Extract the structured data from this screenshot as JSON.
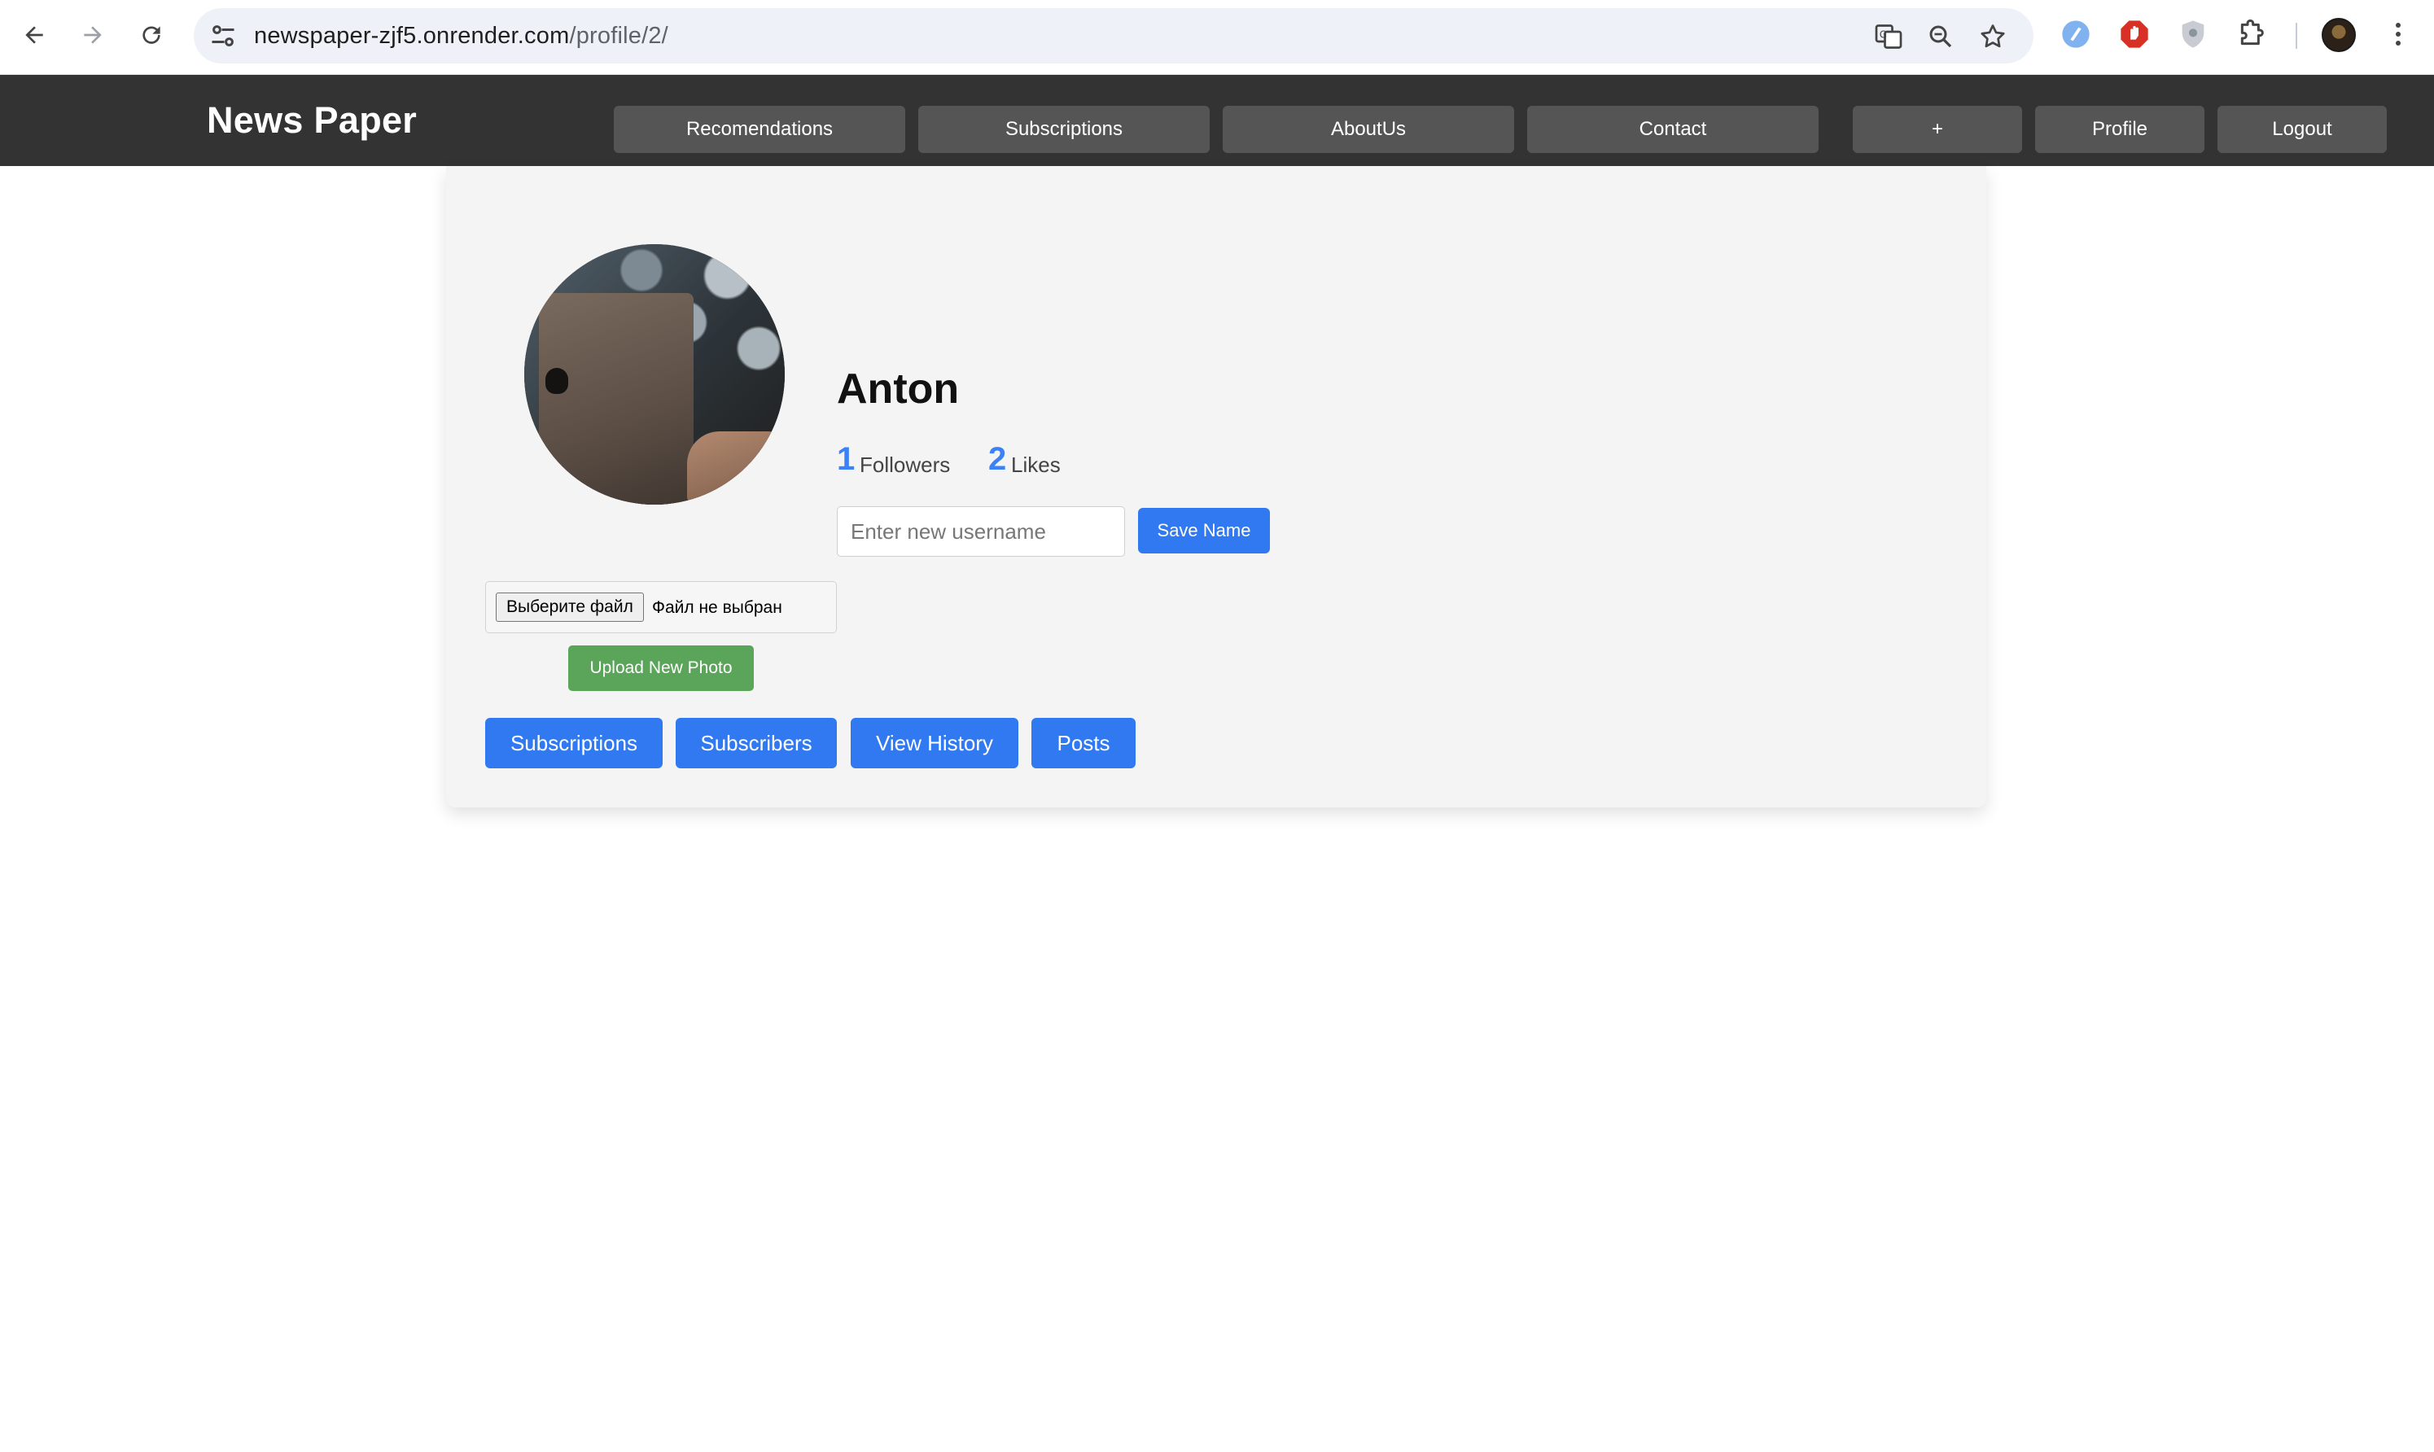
{
  "browser": {
    "url_host": "newspaper-zjf5.onrender.com",
    "url_path": "/profile/2/",
    "icons": [
      "back-icon",
      "forward-icon",
      "reload-icon",
      "site-settings-icon",
      "translate-icon",
      "zoom-icon",
      "bookmark-star-icon",
      "extension-blue-icon",
      "extension-red-icon",
      "extension-shield-icon",
      "extensions-puzzle-icon",
      "profile-avatar",
      "more-menu-icon"
    ]
  },
  "header": {
    "brand": "News Paper",
    "nav": {
      "recomendations": "Recomendations",
      "subscriptions": "Subscriptions",
      "aboutus": "AboutUs",
      "contact": "Contact",
      "add": "+",
      "profile": "Profile",
      "logout": "Logout"
    },
    "colors": {
      "bar": "#333333",
      "button": "#555555"
    }
  },
  "profile": {
    "username": "Anton",
    "followers_count": "1",
    "followers_label": "Followers",
    "likes_count": "2",
    "likes_label": "Likes",
    "username_input_placeholder": "Enter new username",
    "username_input_value": "",
    "save_name_label": "Save Name",
    "file_choose_label": "Выберите файл",
    "file_status": "Файл не выбран",
    "upload_label": "Upload New Photo",
    "tabs": {
      "subscriptions": "Subscriptions",
      "subscribers": "Subscribers",
      "view_history": "View History",
      "posts": "Posts"
    },
    "colors": {
      "accent": "#3079f0",
      "stat": "#3b82f6",
      "upload": "#5aa55a",
      "card": "#f4f4f4"
    }
  }
}
